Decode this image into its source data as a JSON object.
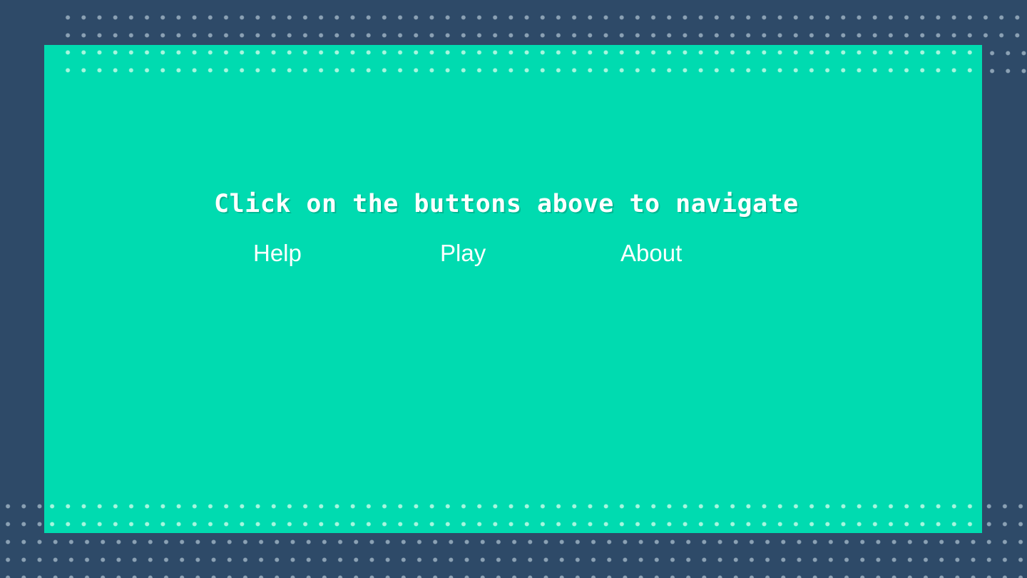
{
  "menu": {
    "instruction": "Click on the buttons above to navigate",
    "buttons": {
      "help": "Help",
      "play": "Play",
      "about": "About"
    }
  },
  "colors": {
    "background": "#2e4a68",
    "panel": "#00dbb0",
    "text": "#ffffff"
  }
}
